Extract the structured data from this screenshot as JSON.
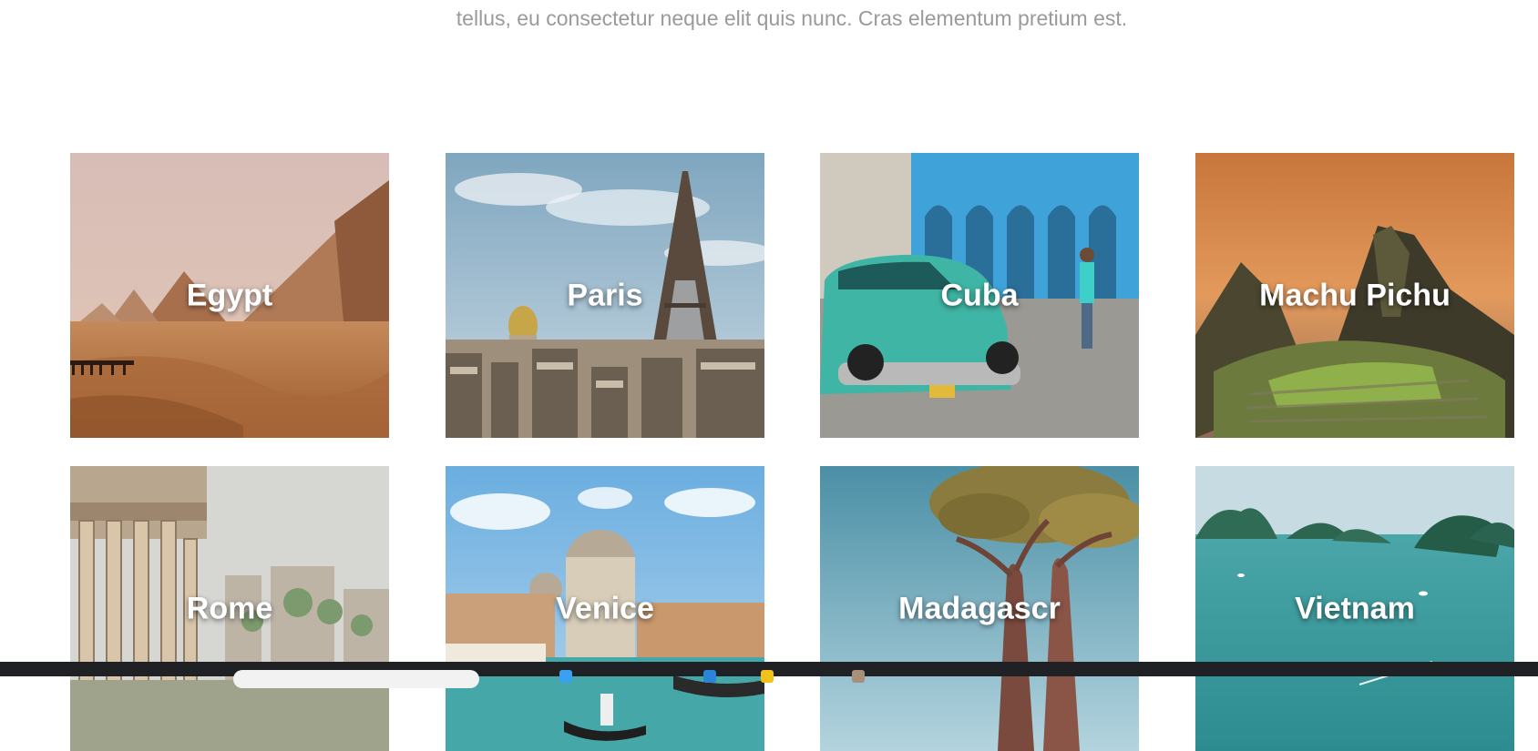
{
  "intro": {
    "text": "tellus, eu consectetur neque elit quis nunc. Cras elementum pretium est."
  },
  "destinations": [
    {
      "label": "Egypt"
    },
    {
      "label": "Paris"
    },
    {
      "label": "Cuba"
    },
    {
      "label": "Machu Pichu"
    },
    {
      "label": "Rome"
    },
    {
      "label": "Venice"
    },
    {
      "label": "Madagascr"
    },
    {
      "label": "Vietnam"
    }
  ],
  "taskbar": {
    "icons": [
      "search-box",
      "edge-icon",
      "store-icon",
      "files-icon",
      "user-avatar-icon",
      "app-icon",
      "app-icon",
      "app-icon",
      "app-icon"
    ]
  }
}
